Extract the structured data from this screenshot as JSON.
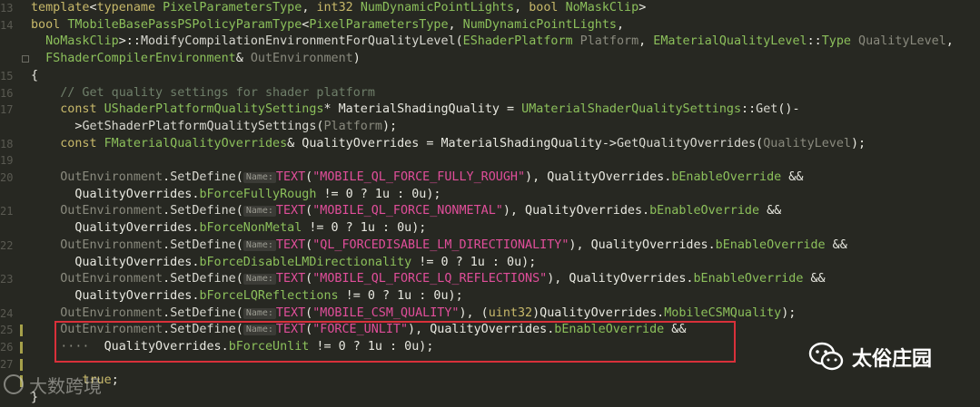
{
  "code_lines": [
    {
      "num": "13",
      "tokens": [
        [
          "kw",
          "template"
        ],
        [
          "tx",
          "<"
        ],
        [
          "kw",
          "typename "
        ],
        [
          "tp",
          "PixelParametersType"
        ],
        [
          "tx",
          ", "
        ],
        [
          "kw",
          "int32 "
        ],
        [
          "tp",
          "NumDynamicPointLights"
        ],
        [
          "tx",
          ", "
        ],
        [
          "kw",
          "bool "
        ],
        [
          "tp",
          "NoMaskClip"
        ],
        [
          "tx",
          ">"
        ]
      ]
    },
    {
      "num": "14",
      "tokens": [
        [
          "kw",
          "bool "
        ],
        [
          "tp",
          "TMobileBasePassPSPolicyParamType"
        ],
        [
          "tx",
          "<"
        ],
        [
          "tp",
          "PixelParametersType"
        ],
        [
          "tx",
          ", "
        ],
        [
          "tp",
          "NumDynamicPointLights"
        ],
        [
          "tx",
          ","
        ]
      ]
    },
    {
      "num": "",
      "tokens": [
        [
          "tx",
          "  "
        ],
        [
          "tp",
          "NoMaskClip"
        ],
        [
          "tx",
          ">::"
        ],
        [
          "fn",
          "ModifyCompilationEnvironmentForQualityLevel"
        ],
        [
          "tx",
          "("
        ],
        [
          "tp",
          "EShaderPlatform "
        ],
        [
          "pm",
          "Platform"
        ],
        [
          "tx",
          ", "
        ],
        [
          "tp",
          "EMaterialQualityLevel"
        ],
        [
          "tx",
          "::"
        ],
        [
          "tp",
          "Type "
        ],
        [
          "pm",
          "QualityLevel"
        ],
        [
          "tx",
          ","
        ]
      ]
    },
    {
      "num": "",
      "tokens": [
        [
          "tx",
          "  "
        ],
        [
          "tp",
          "FShaderCompilerEnvironment"
        ],
        [
          "tx",
          "& "
        ],
        [
          "pm",
          "OutEnvironment"
        ],
        [
          "tx",
          ")"
        ]
      ]
    },
    {
      "num": "15",
      "tokens": [
        [
          "tx",
          "{"
        ]
      ]
    },
    {
      "num": "16",
      "tokens": [
        [
          "cm",
          "    // Get quality settings for shader platform"
        ]
      ]
    },
    {
      "num": "17",
      "tokens": [
        [
          "tx",
          "    "
        ],
        [
          "kw",
          "const "
        ],
        [
          "tp",
          "UShaderPlatformQualitySettings"
        ],
        [
          "tx",
          "* MaterialShadingQuality = "
        ],
        [
          "tp",
          "UMaterialShaderQualitySettings"
        ],
        [
          "tx",
          "::"
        ],
        [
          "fn",
          "Get"
        ],
        [
          "tx",
          "()-"
        ]
      ]
    },
    {
      "num": "",
      "tokens": [
        [
          "tx",
          "      >"
        ],
        [
          "fn",
          "GetShaderPlatformQualitySettings"
        ],
        [
          "tx",
          "("
        ],
        [
          "pm",
          "Platform"
        ],
        [
          "tx",
          ");"
        ]
      ]
    },
    {
      "num": "18",
      "tokens": [
        [
          "tx",
          "    "
        ],
        [
          "kw",
          "const "
        ],
        [
          "tp",
          "FMaterialQualityOverrides"
        ],
        [
          "tx",
          "& QualityOverrides = MaterialShadingQuality->"
        ],
        [
          "fn",
          "GetQualityOverrides"
        ],
        [
          "tx",
          "("
        ],
        [
          "pm",
          "QualityLevel"
        ],
        [
          "tx",
          ");"
        ]
      ]
    },
    {
      "num": "19",
      "tokens": []
    },
    {
      "num": "20",
      "tokens": [
        [
          "tx",
          "    "
        ],
        [
          "pm",
          "OutEnvironment"
        ],
        [
          "tx",
          "."
        ],
        [
          "fn",
          "SetDefine"
        ],
        [
          "tx",
          "("
        ],
        [
          "hint",
          "Name:"
        ],
        [
          "st",
          "TEXT"
        ],
        [
          "tx",
          "("
        ],
        [
          "st",
          "\"MOBILE_QL_FORCE_FULLY_ROUGH\""
        ],
        [
          "tx",
          "), QualityOverrides."
        ],
        [
          "tp",
          "bEnableOverride"
        ],
        [
          "tx",
          " &&"
        ]
      ]
    },
    {
      "num": "",
      "tokens": [
        [
          "tx",
          "      QualityOverrides."
        ],
        [
          "tp",
          "bForceFullyRough"
        ],
        [
          "tx",
          " != 0 ? 1u : 0u);"
        ]
      ]
    },
    {
      "num": "21",
      "tokens": [
        [
          "tx",
          "    "
        ],
        [
          "pm",
          "OutEnvironment"
        ],
        [
          "tx",
          "."
        ],
        [
          "fn",
          "SetDefine"
        ],
        [
          "tx",
          "("
        ],
        [
          "hint",
          "Name:"
        ],
        [
          "st",
          "TEXT"
        ],
        [
          "tx",
          "("
        ],
        [
          "st",
          "\"MOBILE_QL_FORCE_NONMETAL\""
        ],
        [
          "tx",
          "), QualityOverrides."
        ],
        [
          "tp",
          "bEnableOverride"
        ],
        [
          "tx",
          " &&"
        ]
      ]
    },
    {
      "num": "",
      "tokens": [
        [
          "tx",
          "      QualityOverrides."
        ],
        [
          "tp",
          "bForceNonMetal"
        ],
        [
          "tx",
          " != 0 ? 1u : 0u);"
        ]
      ]
    },
    {
      "num": "22",
      "tokens": [
        [
          "tx",
          "    "
        ],
        [
          "pm",
          "OutEnvironment"
        ],
        [
          "tx",
          "."
        ],
        [
          "fn",
          "SetDefine"
        ],
        [
          "tx",
          "("
        ],
        [
          "hint",
          "Name:"
        ],
        [
          "st",
          "TEXT"
        ],
        [
          "tx",
          "("
        ],
        [
          "st",
          "\"QL_FORCEDISABLE_LM_DIRECTIONALITY\""
        ],
        [
          "tx",
          "), QualityOverrides."
        ],
        [
          "tp",
          "bEnableOverride"
        ],
        [
          "tx",
          " &&"
        ]
      ]
    },
    {
      "num": "",
      "tokens": [
        [
          "tx",
          "      QualityOverrides."
        ],
        [
          "tp",
          "bForceDisableLMDirectionality"
        ],
        [
          "tx",
          " != 0 ? 1u : 0u);"
        ]
      ]
    },
    {
      "num": "23",
      "tokens": [
        [
          "tx",
          "    "
        ],
        [
          "pm",
          "OutEnvironment"
        ],
        [
          "tx",
          "."
        ],
        [
          "fn",
          "SetDefine"
        ],
        [
          "tx",
          "("
        ],
        [
          "hint",
          "Name:"
        ],
        [
          "st",
          "TEXT"
        ],
        [
          "tx",
          "("
        ],
        [
          "st",
          "\"MOBILE_QL_FORCE_LQ_REFLECTIONS\""
        ],
        [
          "tx",
          "), QualityOverrides."
        ],
        [
          "tp",
          "bEnableOverride"
        ],
        [
          "tx",
          " &&"
        ]
      ]
    },
    {
      "num": "",
      "tokens": [
        [
          "tx",
          "      QualityOverrides."
        ],
        [
          "tp",
          "bForceLQReflections"
        ],
        [
          "tx",
          " != 0 ? 1u : 0u);"
        ]
      ]
    },
    {
      "num": "24",
      "tokens": [
        [
          "tx",
          "    "
        ],
        [
          "pm",
          "OutEnvironment"
        ],
        [
          "tx",
          "."
        ],
        [
          "fn",
          "SetDefine"
        ],
        [
          "tx",
          "("
        ],
        [
          "hint",
          "Name:"
        ],
        [
          "st",
          "TEXT"
        ],
        [
          "tx",
          "("
        ],
        [
          "st",
          "\"MOBILE_CSM_QUALITY\""
        ],
        [
          "tx",
          "), ("
        ],
        [
          "kw",
          "uint32"
        ],
        [
          "tx",
          ")QualityOverrides."
        ],
        [
          "tp",
          "MobileCSMQuality"
        ],
        [
          "tx",
          ");"
        ]
      ]
    },
    {
      "num": "25",
      "tokens": [
        [
          "tx",
          "    "
        ],
        [
          "pm",
          "OutEnvironment"
        ],
        [
          "tx",
          "."
        ],
        [
          "fn",
          "SetDefine"
        ],
        [
          "tx",
          "("
        ],
        [
          "hint",
          "Name:"
        ],
        [
          "st",
          "TEXT"
        ],
        [
          "tx",
          "("
        ],
        [
          "st",
          "\"FORCE_UNLIT\""
        ],
        [
          "tx",
          "), QualityOverrides."
        ],
        [
          "tp",
          "bEnableOverride"
        ],
        [
          "tx",
          " &&"
        ]
      ]
    },
    {
      "num": "26",
      "tokens": [
        [
          "pm",
          "    ····"
        ],
        [
          "tx",
          "  QualityOverrides."
        ],
        [
          "tp",
          "bForceUnlit"
        ],
        [
          "tx",
          " != 0 ? 1u : 0u);"
        ]
      ]
    },
    {
      "num": "27",
      "tokens": []
    },
    {
      "num": "",
      "tokens": [
        [
          "tx",
          "       "
        ],
        [
          "kw",
          "true"
        ],
        [
          "tx",
          ";"
        ]
      ]
    },
    {
      "num": "",
      "tokens": [
        [
          "tx",
          "}"
        ]
      ]
    }
  ],
  "watermark_left": "大数跨境",
  "watermark_right": "太俗庄园",
  "colors": {
    "background": "#272822",
    "highlight_box": "#d9303a",
    "string": "#e04e9a",
    "type": "#8cc05b",
    "keyword": "#c8b96a"
  }
}
